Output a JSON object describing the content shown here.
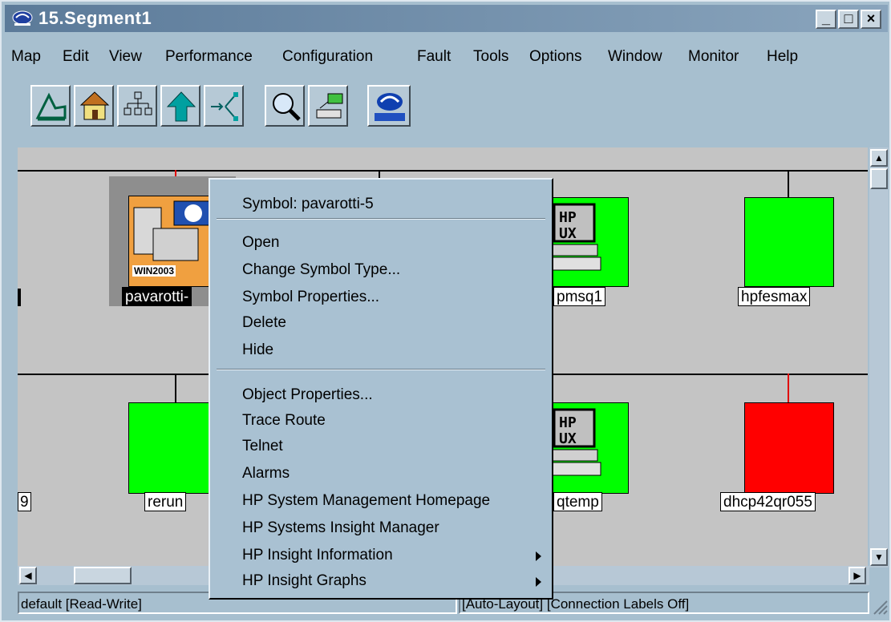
{
  "window": {
    "title": "15.Segment1"
  },
  "titlebar_buttons": {
    "minimize": "_",
    "maximize": "□",
    "close": "×"
  },
  "menu": [
    "Map",
    "Edit",
    "View",
    "Performance",
    "Configuration",
    "Fault",
    "Tools",
    "Options",
    "Window",
    "Monitor",
    "Help"
  ],
  "toolbar": [
    {
      "icon": "map-icon"
    },
    {
      "icon": "home-icon"
    },
    {
      "icon": "hierarchy-icon"
    },
    {
      "icon": "up-arrow-icon"
    },
    {
      "icon": "connect-icon"
    },
    {
      "icon": "find-icon"
    },
    {
      "icon": "network-device-icon"
    },
    {
      "icon": "hp-openview-icon",
      "label": "HP OpenView"
    }
  ],
  "nodes": {
    "pavarotti": {
      "label": "pavarotti-",
      "badge": "WIN2003",
      "status_color": "#f0a040"
    },
    "ipmsq1": {
      "label": "pmsq1",
      "badge": "HP UX",
      "status_color": "#00ff00"
    },
    "hpfesmax": {
      "label": "hpfesmax",
      "status_color": "#00ff00"
    },
    "rerun": {
      "label": "rerun",
      "status_color": "#00ff00"
    },
    "sqtemp": {
      "label": "qtemp",
      "badge": "HP UX",
      "status_color": "#00ff00"
    },
    "dhcp": {
      "label": "dhcp42qr055",
      "status_color": "#ff0000"
    },
    "left_row2": {
      "label": "9"
    }
  },
  "context_menu": {
    "header": "Symbol: pavarotti-5",
    "group1": [
      "Open",
      "Change Symbol Type...",
      "Symbol Properties...",
      "Delete",
      "Hide"
    ],
    "group2": [
      "Object Properties...",
      "Trace Route",
      "Telnet",
      "Alarms",
      "HP System Management Homepage",
      "HP Systems Insight Manager"
    ],
    "submenus": [
      "HP Insight Information",
      "HP Insight Graphs"
    ]
  },
  "status": {
    "left": "default [Read-Write]",
    "right": "[Auto-Layout] [Connection Labels Off]"
  }
}
